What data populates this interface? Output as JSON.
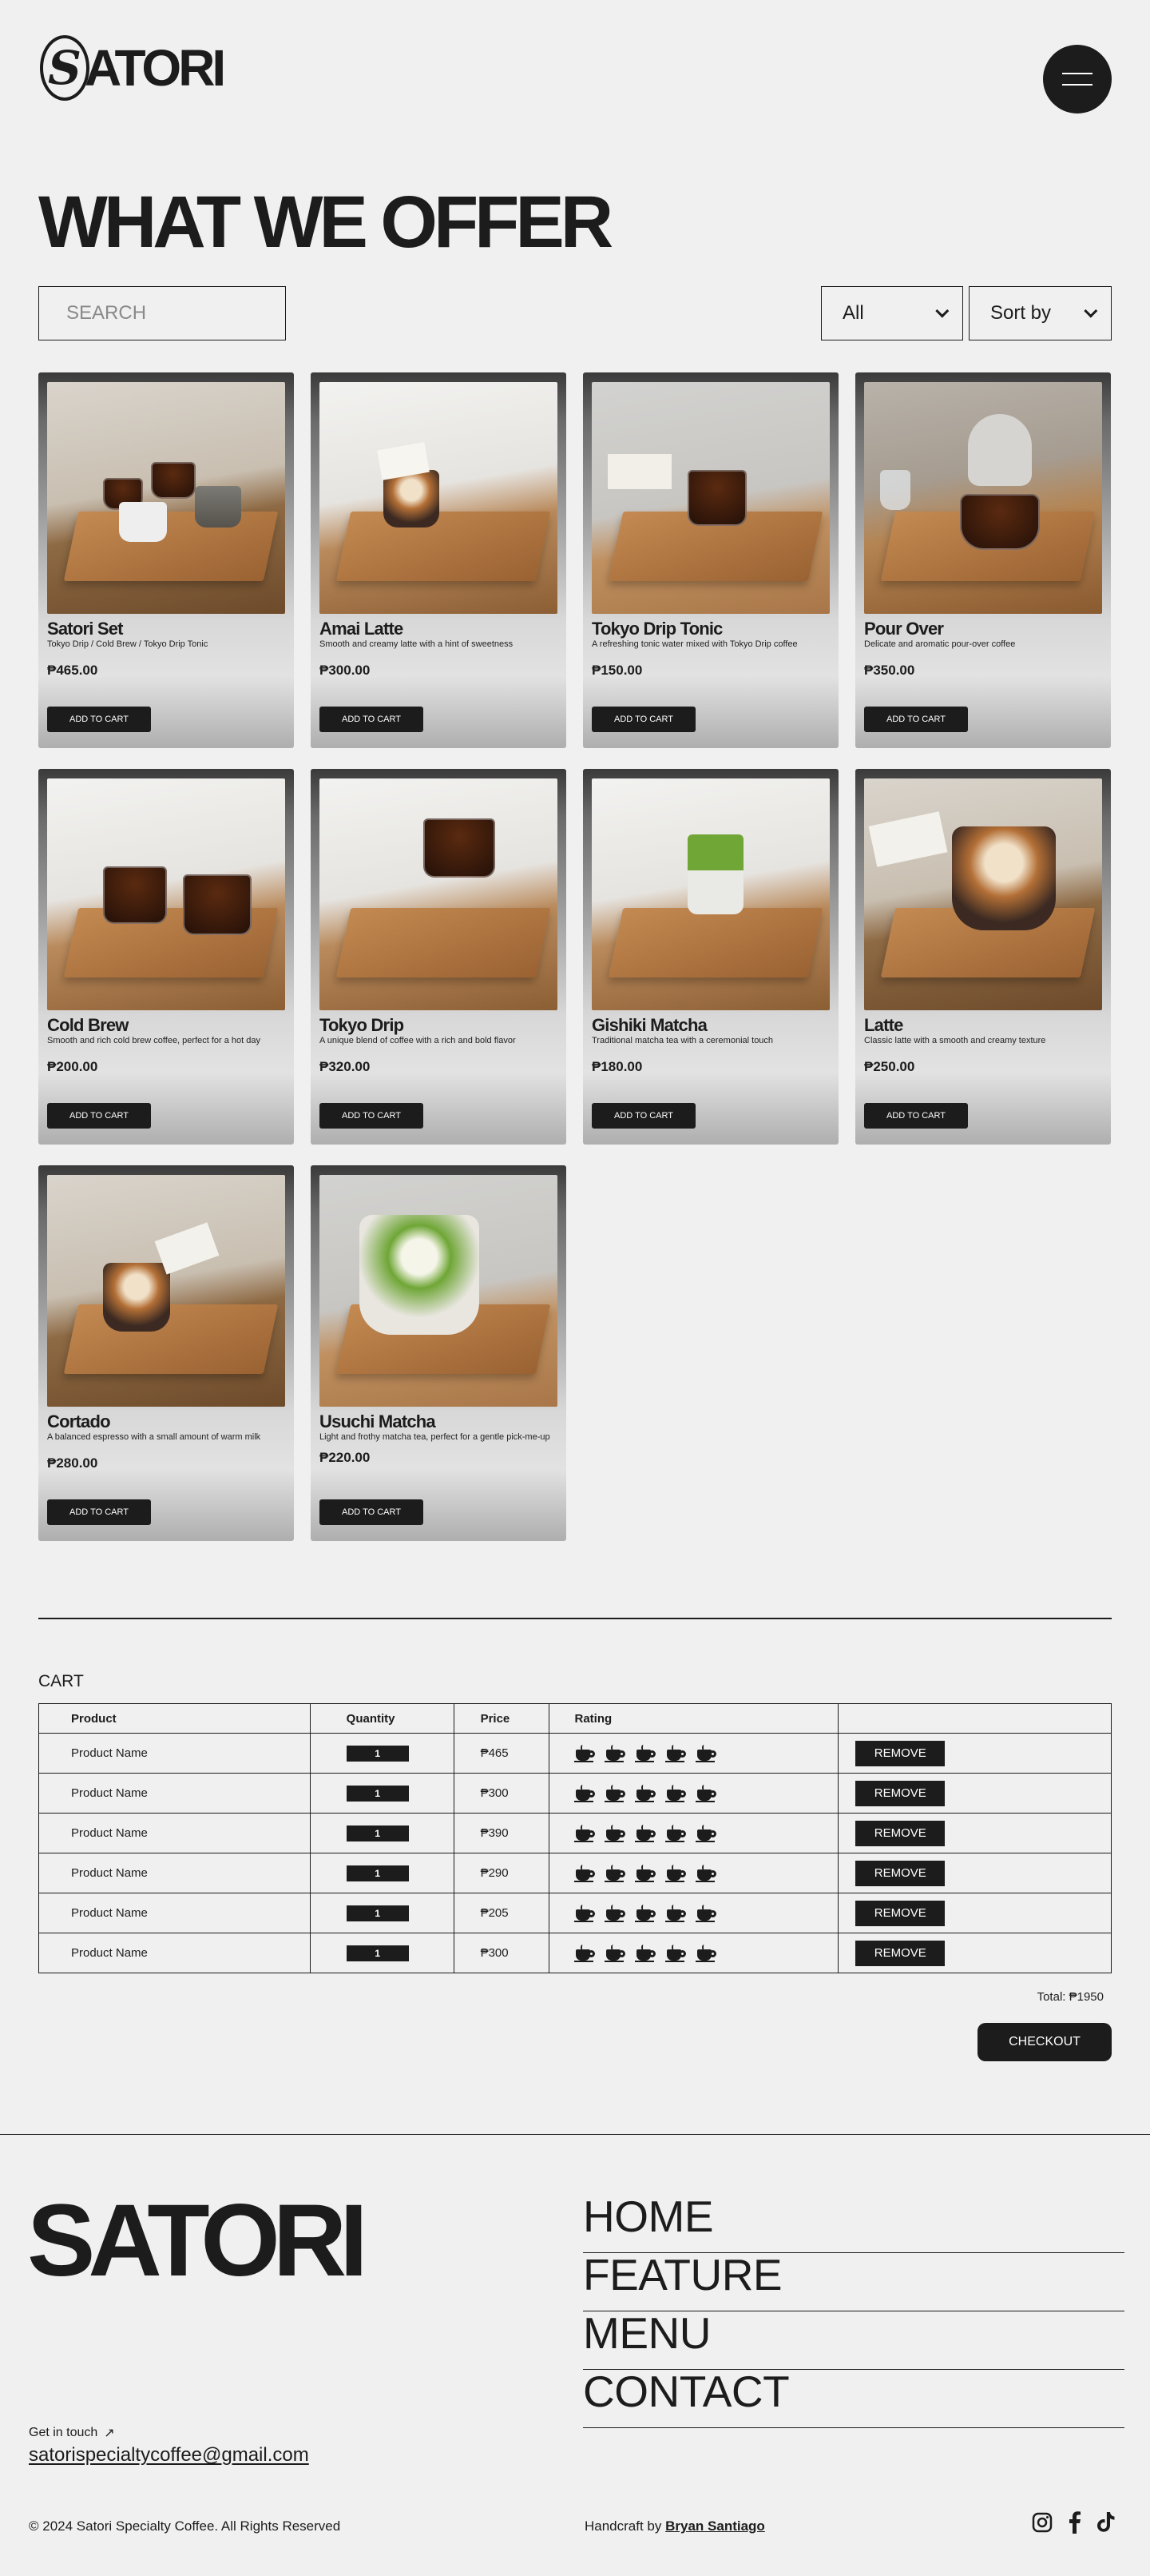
{
  "header": {
    "logo_mark": "S",
    "logo_text": "ATORI"
  },
  "main": {
    "title": "WHAT WE OFFER",
    "search_placeholder": "SEARCH",
    "filter_label": "All",
    "sort_label": "Sort by",
    "add_to_cart_label": "ADD TO CART",
    "products": [
      {
        "name": "Satori Set",
        "desc": "Tokyo Drip / Cold Brew / Tokyo Drip Tonic",
        "price": "₱465.00"
      },
      {
        "name": "Amai Latte",
        "desc": "Smooth and creamy latte with a hint of sweetness",
        "price": "₱300.00"
      },
      {
        "name": "Tokyo Drip Tonic",
        "desc": "A refreshing tonic water mixed with Tokyo Drip coffee",
        "price": "₱150.00"
      },
      {
        "name": "Pour Over",
        "desc": "Delicate and aromatic pour-over coffee",
        "price": "₱350.00"
      },
      {
        "name": "Cold Brew",
        "desc": "Smooth and rich cold brew coffee, perfect for a hot day",
        "price": "₱200.00"
      },
      {
        "name": "Tokyo Drip",
        "desc": "A unique blend of coffee with a rich and bold flavor",
        "price": "₱320.00"
      },
      {
        "name": "Gishiki Matcha",
        "desc": "Traditional matcha tea with a ceremonial touch",
        "price": "₱180.00"
      },
      {
        "name": "Latte",
        "desc": "Classic latte with a smooth and creamy texture",
        "price": "₱250.00"
      },
      {
        "name": "Cortado",
        "desc": "A balanced espresso with a small amount of warm milk",
        "price": "₱280.00"
      },
      {
        "name": "Usuchi Matcha",
        "desc": "Light and frothy matcha tea, perfect for a gentle pick-me-up",
        "price": "₱220.00"
      }
    ]
  },
  "cart": {
    "title": "CART",
    "headers": {
      "product": "Product",
      "quantity": "Quantity",
      "price": "Price",
      "rating": "Rating"
    },
    "remove_label": "REMOVE",
    "rows": [
      {
        "name": "Product Name",
        "qty": "1",
        "price": "₱465",
        "rating": 5
      },
      {
        "name": "Product Name",
        "qty": "1",
        "price": "₱300",
        "rating": 5
      },
      {
        "name": "Product Name",
        "qty": "1",
        "price": "₱390",
        "rating": 5
      },
      {
        "name": "Product Name",
        "qty": "1",
        "price": "₱290",
        "rating": 5
      },
      {
        "name": "Product Name",
        "qty": "1",
        "price": "₱205",
        "rating": 5
      },
      {
        "name": "Product Name",
        "qty": "1",
        "price": "₱300",
        "rating": 5
      }
    ],
    "total": "Total: ₱1950",
    "checkout_label": "CHECKOUT"
  },
  "footer": {
    "brand": "SATORI",
    "nav": [
      "HOME",
      "FEATURE",
      "MENU",
      "CONTACT"
    ],
    "get_in_touch": "Get in touch",
    "email": "satorispecialtycoffee@gmail.com",
    "copyright": "© 2024 Satori Specialty Coffee. All Rights Reserved",
    "credit_prefix": "Handcraft by",
    "credit_name": "Bryan Santiago",
    "socials": [
      "instagram-icon",
      "facebook-icon",
      "tiktok-icon"
    ]
  }
}
